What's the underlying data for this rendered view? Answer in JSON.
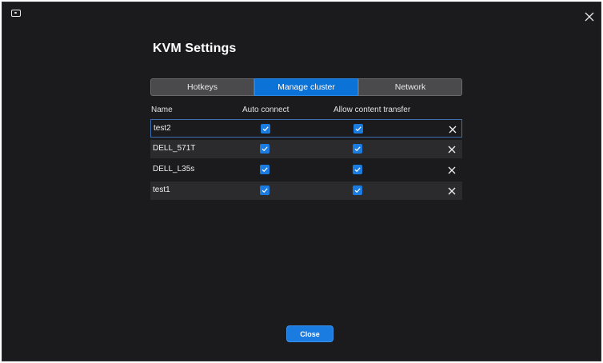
{
  "window": {
    "title": "KVM Settings"
  },
  "tabs": [
    {
      "label": "Hotkeys",
      "active": false
    },
    {
      "label": "Manage cluster",
      "active": true
    },
    {
      "label": "Network",
      "active": false
    }
  ],
  "table": {
    "columns": [
      "Name",
      "Auto connect",
      "Allow content transfer"
    ],
    "rows": [
      {
        "name": "test2",
        "auto_connect": true,
        "allow_content_transfer": true
      },
      {
        "name": "DELL_571T",
        "auto_connect": true,
        "allow_content_transfer": true
      },
      {
        "name": "DELL_L35s",
        "auto_connect": true,
        "allow_content_transfer": true
      },
      {
        "name": "test1",
        "auto_connect": true,
        "allow_content_transfer": true
      }
    ]
  },
  "footer": {
    "close_label": "Close"
  },
  "colors": {
    "accent": "#1a7be0",
    "background": "#1b1b1d",
    "row_alt": "#2b2b2e",
    "tab_inactive": "#4a4a4c"
  },
  "icons": {
    "app": "monitor-icon",
    "close": "close-icon",
    "row_delete": "close-icon",
    "check": "checkmark-icon"
  }
}
